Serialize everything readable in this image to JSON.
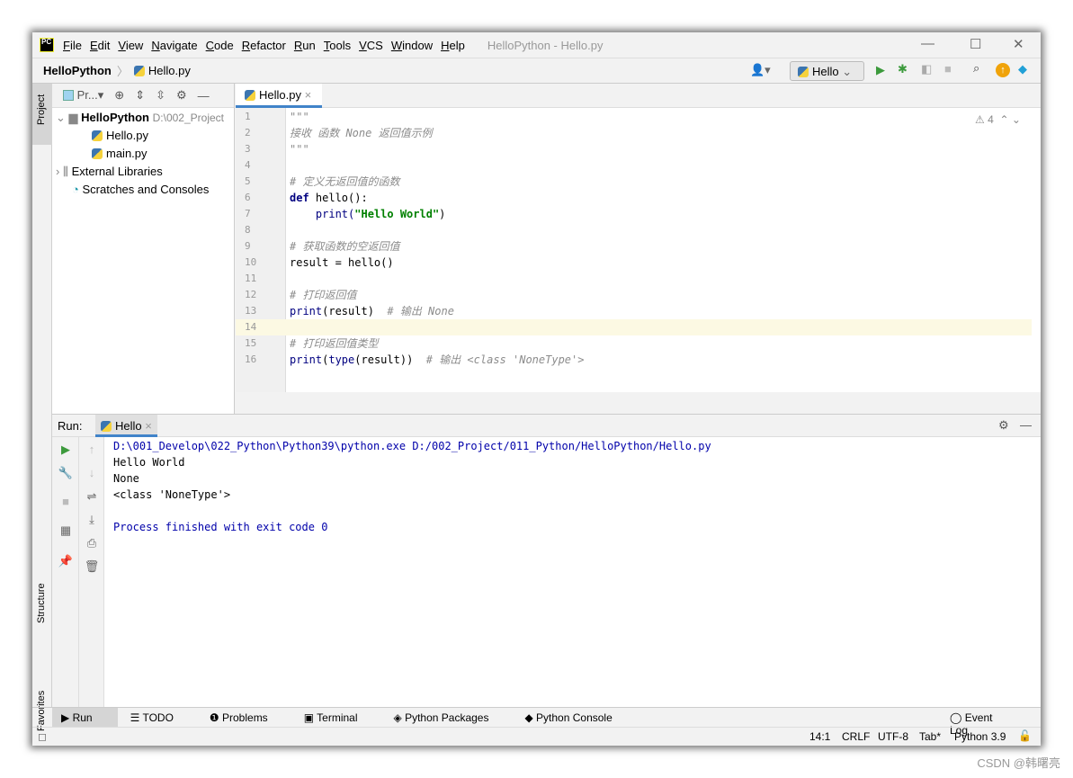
{
  "window": {
    "title": "HelloPython - Hello.py",
    "logo": "PC"
  },
  "menu": [
    "File",
    "Edit",
    "View",
    "Navigate",
    "Code",
    "Refactor",
    "Run",
    "Tools",
    "VCS",
    "Window",
    "Help"
  ],
  "navbar": {
    "project": "HelloPython",
    "file": "Hello.py",
    "run_config": "Hello"
  },
  "stripe": {
    "project": "Project",
    "structure": "Structure",
    "favorites": "Favorites"
  },
  "project_panel": {
    "view": "Pr...",
    "root": "HelloPython",
    "root_path": "D:\\002_Project",
    "files": [
      "Hello.py",
      "main.py"
    ],
    "external": "External Libraries",
    "scratches": "Scratches and Consoles"
  },
  "editor": {
    "tab": "Hello.py",
    "warnings": "4",
    "current_line": 14,
    "lines": [
      "1",
      "2",
      "3",
      "4",
      "5",
      "6",
      "7",
      "8",
      "9",
      "10",
      "11",
      "12",
      "13",
      "14",
      "15",
      "16"
    ]
  },
  "code": {
    "l1": "\"\"\"",
    "l2": "接收 函数 None 返回值示例",
    "l3": "\"\"\"",
    "l5": "# 定义无返回值的函数",
    "l6a": "def",
    "l6b": " hello():",
    "l7a": "    print(",
    "l7b": "\"Hello World\"",
    "l7c": ")",
    "l9": "# 获取函数的空返回值",
    "l10": "result = hello()",
    "l12": "# 打印返回值",
    "l13a": "print",
    "l13b": "(result)  ",
    "l13c": "# 输出 None",
    "l15": "# 打印返回值类型",
    "l16a": "print",
    "l16b": "(",
    "l16c": "type",
    "l16d": "(result))  ",
    "l16e": "# 输出 <class 'NoneType'>"
  },
  "run": {
    "label": "Run:",
    "tab": "Hello",
    "output": [
      "D:\\001_Develop\\022_Python\\Python39\\python.exe D:/002_Project/011_Python/HelloPython/Hello.py",
      "Hello World",
      "None",
      "<class 'NoneType'>",
      "",
      "Process finished with exit code 0"
    ]
  },
  "toolwindows": [
    "Run",
    "TODO",
    "Problems",
    "Terminal",
    "Python Packages",
    "Python Console"
  ],
  "event_log": "Event Log",
  "status": {
    "position": "14:1",
    "line_sep": "CRLF",
    "encoding": "UTF-8",
    "indent": "Tab*",
    "interpreter": "Python 3.9"
  },
  "watermark": "CSDN @韩曙亮"
}
